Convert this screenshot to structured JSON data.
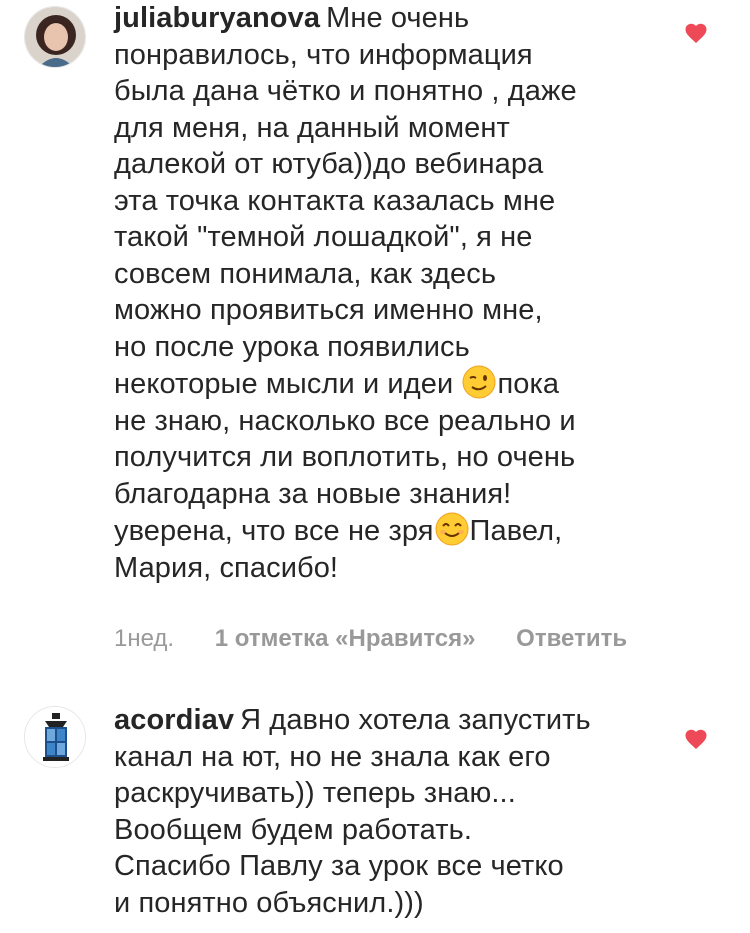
{
  "colors": {
    "text": "#262626",
    "meta": "#999999",
    "heart": "#ed4956"
  },
  "comments": [
    {
      "username": "juliaburyanova",
      "avatar_icon": "user-avatar-photo",
      "lines": [
        "Мне очень",
        "понравилось, что информация",
        "была дана чётко и понятно , даже",
        "для меня, на данный момент",
        "далекой от ютуба))до вебинара",
        "эта точка контакта казалась мне",
        "такой \"темной лошадкой\", я не",
        "совсем понимала, как здесь",
        "можно проявиться именно мне,",
        "но после урока появились",
        "некоторые мысли и идеи",
        "пока",
        "не знаю, насколько все реально и",
        "получится ли воплотить, но очень",
        "благодарна за новые знания!",
        "уверена, что все не зря",
        "Павел,",
        "Мария, спасибо!"
      ],
      "emoji_1": "winking-face-emoji",
      "emoji_2": "smiling-face-emoji",
      "time": "1нед.",
      "likes": "1 отметка «Нравится»",
      "reply": "Ответить",
      "like_icon": "heart-icon"
    },
    {
      "username": "acordiav",
      "avatar_icon": "user-avatar-lantern",
      "lines": [
        "Я давно хотела запустить",
        "канал на ют, но не знала как его",
        "раскручивать)) теперь знаю...",
        "Вообщем будем работать.",
        "Спасибо Павлу за урок все четко",
        "и понятно объяснил.)))"
      ],
      "like_icon": "heart-icon"
    }
  ]
}
